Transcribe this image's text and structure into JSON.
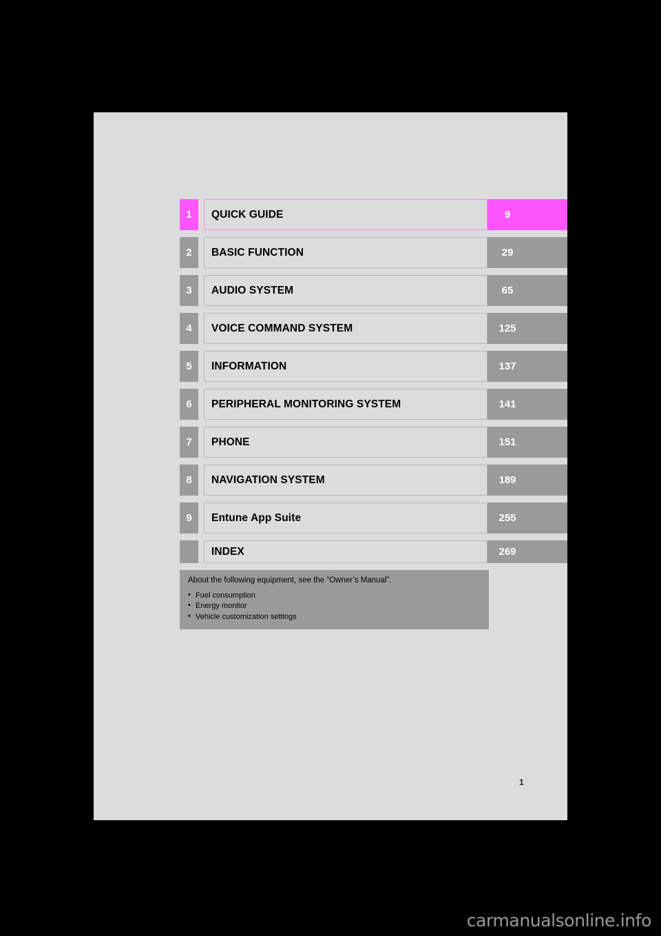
{
  "page": {
    "folio": "1",
    "background_color": "#dcdcdc",
    "accent_color": "#fc56fc",
    "neutral_color": "#9a9a9a"
  },
  "toc": {
    "rows": [
      {
        "number": "1",
        "title": "QUICK GUIDE",
        "page": "9",
        "accent": true
      },
      {
        "number": "2",
        "title": "BASIC FUNCTION",
        "page": "29",
        "accent": false
      },
      {
        "number": "3",
        "title": "AUDIO SYSTEM",
        "page": "65",
        "accent": false
      },
      {
        "number": "4",
        "title": "VOICE COMMAND SYSTEM",
        "page": "125",
        "accent": false
      },
      {
        "number": "5",
        "title": "INFORMATION",
        "page": "137",
        "accent": false
      },
      {
        "number": "6",
        "title": "PERIPHERAL MONITORING SYSTEM",
        "page": "141",
        "accent": false
      },
      {
        "number": "7",
        "title": "PHONE",
        "page": "151",
        "accent": false
      },
      {
        "number": "8",
        "title": "NAVIGATION SYSTEM",
        "page": "189",
        "accent": false
      },
      {
        "number": "9",
        "title": "Entune App Suite",
        "page": "255",
        "accent": false
      },
      {
        "number": "",
        "title": "INDEX",
        "page": "269",
        "accent": false
      }
    ]
  },
  "note": {
    "heading": "About the following equipment, see the “Owner’s Manual”.",
    "items": [
      "Fuel consumption",
      "Energy monitor",
      "Vehicle customization settings"
    ]
  },
  "watermark": {
    "text": "carmanualsonline.info"
  }
}
